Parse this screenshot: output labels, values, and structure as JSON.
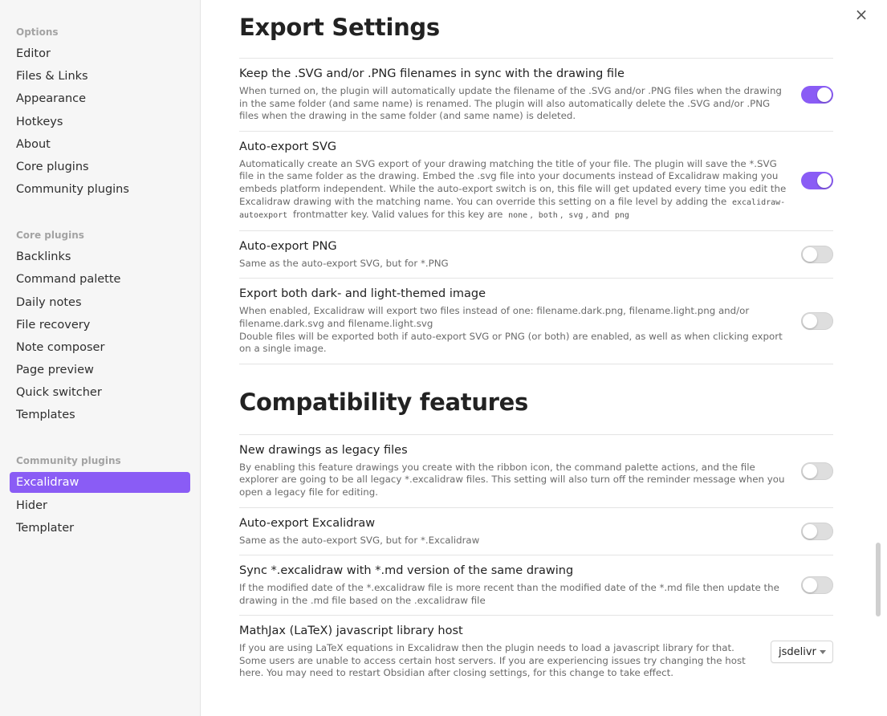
{
  "sidebar": {
    "options_title": "Options",
    "options": [
      "Editor",
      "Files & Links",
      "Appearance",
      "Hotkeys",
      "About",
      "Core plugins",
      "Community plugins"
    ],
    "core_title": "Core plugins",
    "core": [
      "Backlinks",
      "Command palette",
      "Daily notes",
      "File recovery",
      "Note composer",
      "Page preview",
      "Quick switcher",
      "Templates"
    ],
    "community_title": "Community plugins",
    "community": [
      "Excalidraw",
      "Hider",
      "Templater"
    ],
    "active": "Excalidraw"
  },
  "export": {
    "title": "Export Settings",
    "s1_name": "Keep the .SVG and/or .PNG filenames in sync with the drawing file",
    "s1_desc": "When turned on, the plugin will automatically update the filename of the .SVG and/or .PNG files when the drawing in the same folder (and same name) is renamed. The plugin will also automatically delete the .SVG and/or .PNG files when the drawing in the same folder (and same name) is deleted.",
    "s2_name": "Auto-export SVG",
    "s2_desc_a": "Automatically create an SVG export of your drawing matching the title of your file. The plugin will save the *.SVG file in the same folder as the drawing. Embed the .svg file into your documents instead of Excalidraw making you embeds platform independent. While the auto-export switch is on, this file will get updated every time you edit the Excalidraw drawing with the matching name. You can override this setting on a file level by adding the",
    "s2_code_key": "excalidraw-autoexport",
    "s2_desc_b": "frontmatter key. Valid values for this key are",
    "s2_code_none": "none",
    "s2_code_both": "both",
    "s2_code_svg": "svg",
    "s2_code_png": "png",
    "s2_and": "and",
    "s3_name": "Auto-export PNG",
    "s3_desc": "Same as the auto-export SVG, but for *.PNG",
    "s4_name": "Export both dark- and light-themed image",
    "s4_desc_1": "When enabled, Excalidraw will export two files instead of one: filename.dark.png, filename.light.png and/or filename.dark.svg and filename.light.svg",
    "s4_desc_2": "Double files will be exported both if auto-export SVG or PNG (or both) are enabled, as well as when clicking export on a single image."
  },
  "compat": {
    "title": "Compatibility features",
    "c1_name": "New drawings as legacy files",
    "c1_desc": "By enabling this feature drawings you create with the ribbon icon, the command palette actions, and the file explorer are going to be all legacy *.excalidraw files. This setting will also turn off the reminder message when you open a legacy file for editing.",
    "c2_name": "Auto-export Excalidraw",
    "c2_desc": "Same as the auto-export SVG, but for *.Excalidraw",
    "c3_name": "Sync *.excalidraw with *.md version of the same drawing",
    "c3_desc": "If the modified date of the *.excalidraw file is more recent than the modified date of the *.md file then update the drawing in the .md file based on the .excalidraw file",
    "c4_name": "MathJax (LaTeX) javascript library host",
    "c4_desc": "If you are using LaTeX equations in Excalidraw then the plugin needs to load a javascript library for that. Some users are unable to access certain host servers. If you are experiencing issues try changing the host here. You may need to restart Obsidian after closing settings, for this change to take effect.",
    "c4_value": "jsdelivr"
  },
  "toggles": {
    "keep_sync": true,
    "auto_svg": true,
    "auto_png": false,
    "dark_light": false,
    "legacy": false,
    "auto_excalidraw": false,
    "sync_md": false
  },
  "close_icon": "×",
  "accent_color": "#8a5cf5"
}
